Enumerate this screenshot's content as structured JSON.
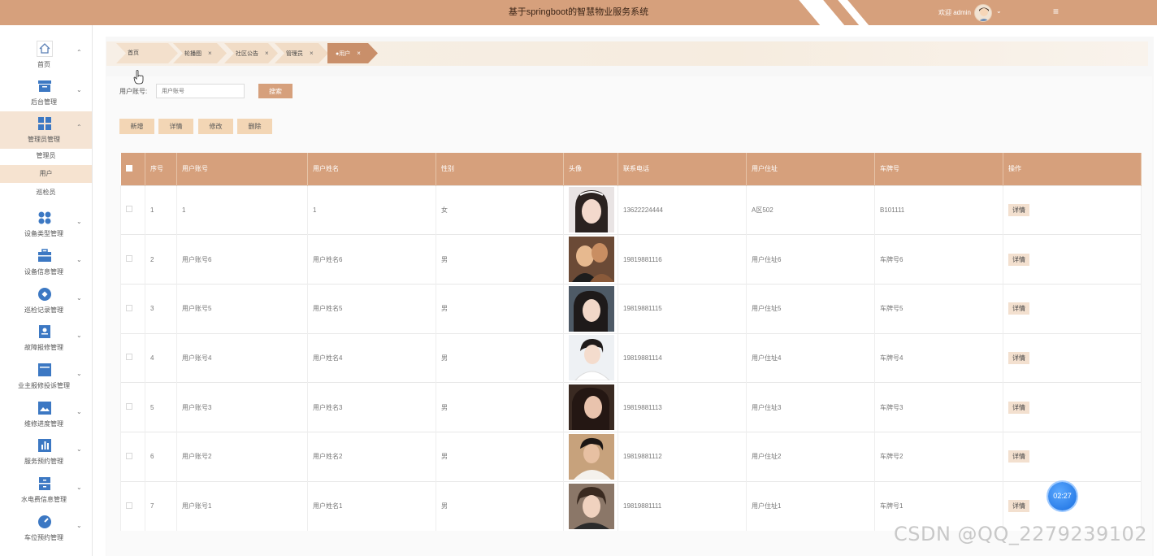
{
  "header": {
    "title": "基于springboot的智慧物业服务系统",
    "welcome": "欢迎 admin",
    "menu_icon": "hamburger-icon",
    "color": "#d6a07c"
  },
  "sidebar": {
    "items": [
      {
        "label": "首页",
        "icon": "home-icon"
      },
      {
        "label": "后台管理",
        "icon": "archive-icon"
      },
      {
        "label": "管理员管理",
        "icon": "grid-icon",
        "sub": [
          "管理员",
          "用户",
          "巡检员"
        ]
      },
      {
        "label": "设备类型管理",
        "icon": "apps-icon"
      },
      {
        "label": "设备信息管理",
        "icon": "briefcase-icon"
      },
      {
        "label": "巡检记录管理",
        "icon": "target-icon"
      },
      {
        "label": "故障报修管理",
        "icon": "id-card-icon"
      },
      {
        "label": "业主报修投诉管理",
        "icon": "window-icon"
      },
      {
        "label": "维修进度管理",
        "icon": "image-icon"
      },
      {
        "label": "服务预约管理",
        "icon": "bar-icon"
      },
      {
        "label": "水电费信息管理",
        "icon": "cabinet-icon"
      },
      {
        "label": "车位预约管理",
        "icon": "gauge-icon"
      }
    ]
  },
  "tabs": [
    {
      "label": "首页",
      "closable": false
    },
    {
      "label": "轮播图",
      "closable": true
    },
    {
      "label": "社区公告",
      "closable": true
    },
    {
      "label": "管理员",
      "closable": true
    },
    {
      "label": "●用户",
      "closable": true,
      "active": true
    }
  ],
  "tab_close": "×",
  "search": {
    "label": "用户账号:",
    "placeholder": "用户账号",
    "button": "搜索"
  },
  "actions": {
    "add": "新增",
    "detail": "详情",
    "edit": "修改",
    "delete": "删除"
  },
  "table": {
    "columns": [
      "序号",
      "用户账号",
      "用户姓名",
      "性别",
      "头像",
      "联系电话",
      "用户住址",
      "车牌号",
      "操作"
    ],
    "rows": [
      {
        "no": "1",
        "account": "1",
        "name": "1",
        "gender": "女",
        "phone": "13622224444",
        "address": "A区502",
        "plate": "B101111",
        "action": "详情"
      },
      {
        "no": "2",
        "account": "用户账号6",
        "name": "用户姓名6",
        "gender": "男",
        "phone": "19819881116",
        "address": "用户住址6",
        "plate": "车牌号6",
        "action": "详情"
      },
      {
        "no": "3",
        "account": "用户账号5",
        "name": "用户姓名5",
        "gender": "男",
        "phone": "19819881115",
        "address": "用户住址5",
        "plate": "车牌号5",
        "action": "详情"
      },
      {
        "no": "4",
        "account": "用户账号4",
        "name": "用户姓名4",
        "gender": "男",
        "phone": "19819881114",
        "address": "用户住址4",
        "plate": "车牌号4",
        "action": "详情"
      },
      {
        "no": "5",
        "account": "用户账号3",
        "name": "用户姓名3",
        "gender": "男",
        "phone": "19819881113",
        "address": "用户住址3",
        "plate": "车牌号3",
        "action": "详情"
      },
      {
        "no": "6",
        "account": "用户账号2",
        "name": "用户姓名2",
        "gender": "男",
        "phone": "19819881112",
        "address": "用户住址2",
        "plate": "车牌号2",
        "action": "详情"
      },
      {
        "no": "7",
        "account": "用户账号1",
        "name": "用户姓名1",
        "gender": "男",
        "phone": "19819881111",
        "address": "用户住址1",
        "plate": "车牌号1",
        "action": "详情"
      }
    ]
  },
  "timer": "02:27",
  "watermark": "CSDN @QQ_2279239102"
}
